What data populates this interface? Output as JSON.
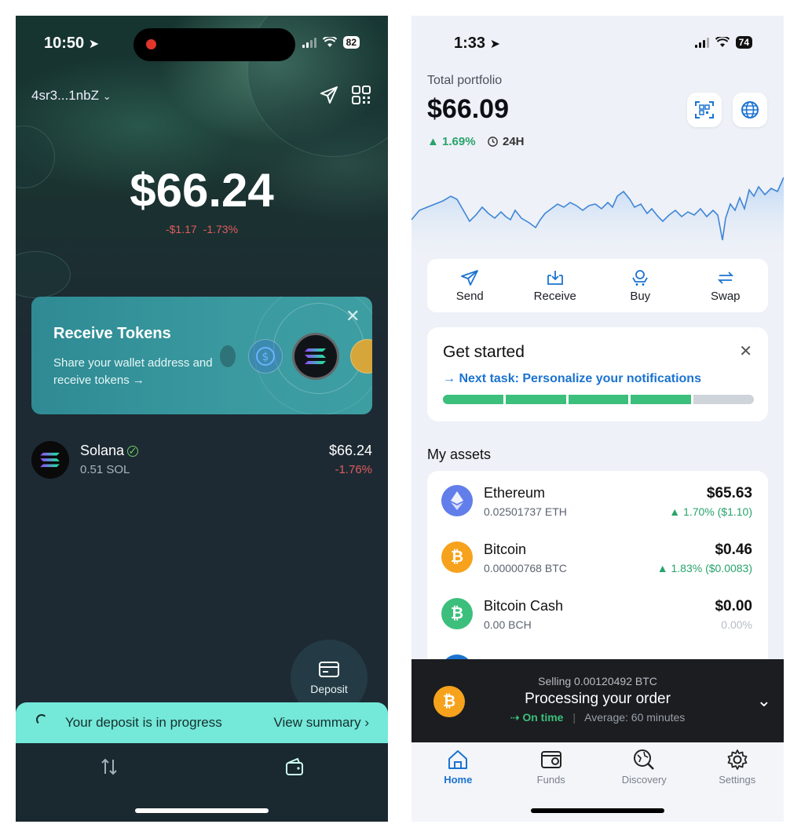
{
  "left": {
    "status": {
      "time": "10:50",
      "battery": "82"
    },
    "wallet_address": "4sr3...1nbZ",
    "balance": "$66.24",
    "change_abs": "-$1.17",
    "change_pct": "-1.73%",
    "receive_card": {
      "title": "Receive Tokens",
      "desc": "Share your wallet address and receive tokens →"
    },
    "token": {
      "name": "Solana",
      "amount": "0.51 SOL",
      "value": "$66.24",
      "change": "-1.76%"
    },
    "deposit_button": "Deposit",
    "deposit_bar": {
      "text": "Your deposit is in progress",
      "action": "View summary"
    },
    "icons": [
      "send-icon",
      "qr-icon",
      "close-icon",
      "swap-icon",
      "wallet-icon",
      "card-icon"
    ]
  },
  "right": {
    "status": {
      "time": "1:33",
      "battery": "74"
    },
    "total_label": "Total portfolio",
    "total_value": "$66.09",
    "total_change": "▲ 1.69%",
    "period": "24H",
    "actions": [
      {
        "label": "Send",
        "icon": "send-icon"
      },
      {
        "label": "Receive",
        "icon": "receive-icon"
      },
      {
        "label": "Buy",
        "icon": "buy-icon"
      },
      {
        "label": "Swap",
        "icon": "swap-icon"
      }
    ],
    "get_started": {
      "title": "Get started",
      "task": "→  Next task: Personalize your notifications",
      "progress_done": 4,
      "progress_total": 5
    },
    "assets_heading": "My assets",
    "assets": [
      {
        "name": "Ethereum",
        "amount": "0.02501737 ETH",
        "value": "$65.63",
        "change": "▲ 1.70% ($1.10)",
        "color": "#627eea"
      },
      {
        "name": "Bitcoin",
        "amount": "0.00000768 BTC",
        "value": "$0.46",
        "change": "▲ 1.83% ($0.0083)",
        "color": "#f6a21c"
      },
      {
        "name": "Bitcoin Cash",
        "amount": "0.00 BCH",
        "value": "$0.00",
        "change": "0.00%",
        "color": "#3cbf7c"
      }
    ],
    "order": {
      "sub": "Selling 0.00120492 BTC",
      "main": "Processing your order",
      "status": "On time",
      "eta": "Average: 60 minutes"
    },
    "tabs": [
      {
        "label": "Home",
        "icon": "home-icon"
      },
      {
        "label": "Funds",
        "icon": "funds-icon"
      },
      {
        "label": "Discovery",
        "icon": "discovery-icon"
      },
      {
        "label": "Settings",
        "icon": "settings-icon"
      }
    ],
    "colors": {
      "accent": "#1b73d0",
      "positive": "#27a36a",
      "progress": "#3cbf7c"
    }
  }
}
